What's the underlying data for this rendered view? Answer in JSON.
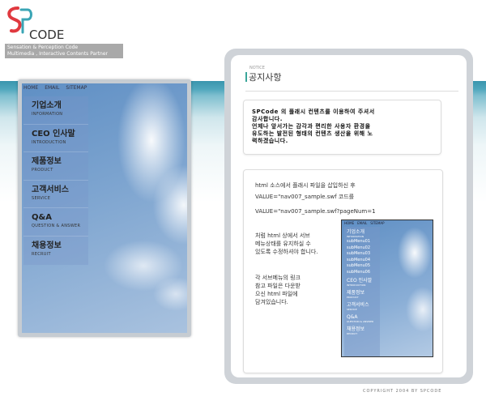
{
  "brand": {
    "logo_text": "CODE",
    "tagline_line1": "Sensation & Perception Code",
    "tagline_line2": "Multimedia , Interactive Contents Partner"
  },
  "left_preview": {
    "topnav": [
      "HOME",
      "EMAIL",
      "SITEMAP"
    ],
    "menu": [
      {
        "ko": "기업소개",
        "en": "INFORMATION"
      },
      {
        "ko": "CEO 인사말",
        "en": "INTRODUCTION"
      },
      {
        "ko": "제품정보",
        "en": "PRODUCT"
      },
      {
        "ko": "고객서비스",
        "en": "SERVICE"
      },
      {
        "ko": "Q&A",
        "en": "QUESTION & ANSWER"
      },
      {
        "ko": "채용정보",
        "en": "RECRUIT"
      }
    ]
  },
  "notice": {
    "label_en": "NOTICE",
    "title": "공지사항",
    "intro": [
      "SPCode 의 플래시 컨텐츠를 이용하여 주셔서",
      "감사합니다.",
      "언제나 앞서가는 감각과 편리한 사용자 환경을",
      "유도하는 발전된 형태의 컨텐츠 생산을 위해 노",
      "력하겠습니다."
    ],
    "instructions": {
      "line1": "html 소스에서 플래시 파일을 삽입하신 후",
      "line2": "VALUE=\"nav007_sample.swf     코드를",
      "line3": "VALUE=\"nav007_sample.swf?pageNum=1",
      "para2": [
        "처럼 html 상에서 서브",
        "메뉴상태를 유지하실 수",
        "있도록 수정하셔야 합니다."
      ],
      "para3": [
        "각 서브메뉴의 링크",
        "참고 파일은 다운받",
        "으신 html 파일에",
        "담겨있습니다."
      ]
    },
    "mini_preview": {
      "topnav": [
        "HOME",
        "EMAIL",
        "SITEMAP"
      ],
      "first": {
        "ko": "기업소개",
        "en": "INFORMATION"
      },
      "submenus": [
        "subMenu01",
        "subMenu02",
        "subMenu03",
        "subMenu04",
        "subMenu05",
        "subMenu06"
      ],
      "rest": [
        {
          "ko": "CEO 인사말",
          "en": "INTRODUCTION"
        },
        {
          "ko": "제품정보",
          "en": "PRODUCT"
        },
        {
          "ko": "고객서비스",
          "en": "SERVICE"
        },
        {
          "ko": "Q&A",
          "en": "QUESTION & ANSWER"
        },
        {
          "ko": "채용정보",
          "en": "RECRUIT"
        }
      ]
    }
  },
  "footer": {
    "copyright": "COPYRIGHT 2004 BY SPCODE"
  },
  "colors": {
    "accent": "#e0393f",
    "teal": "#3aa5b5"
  }
}
